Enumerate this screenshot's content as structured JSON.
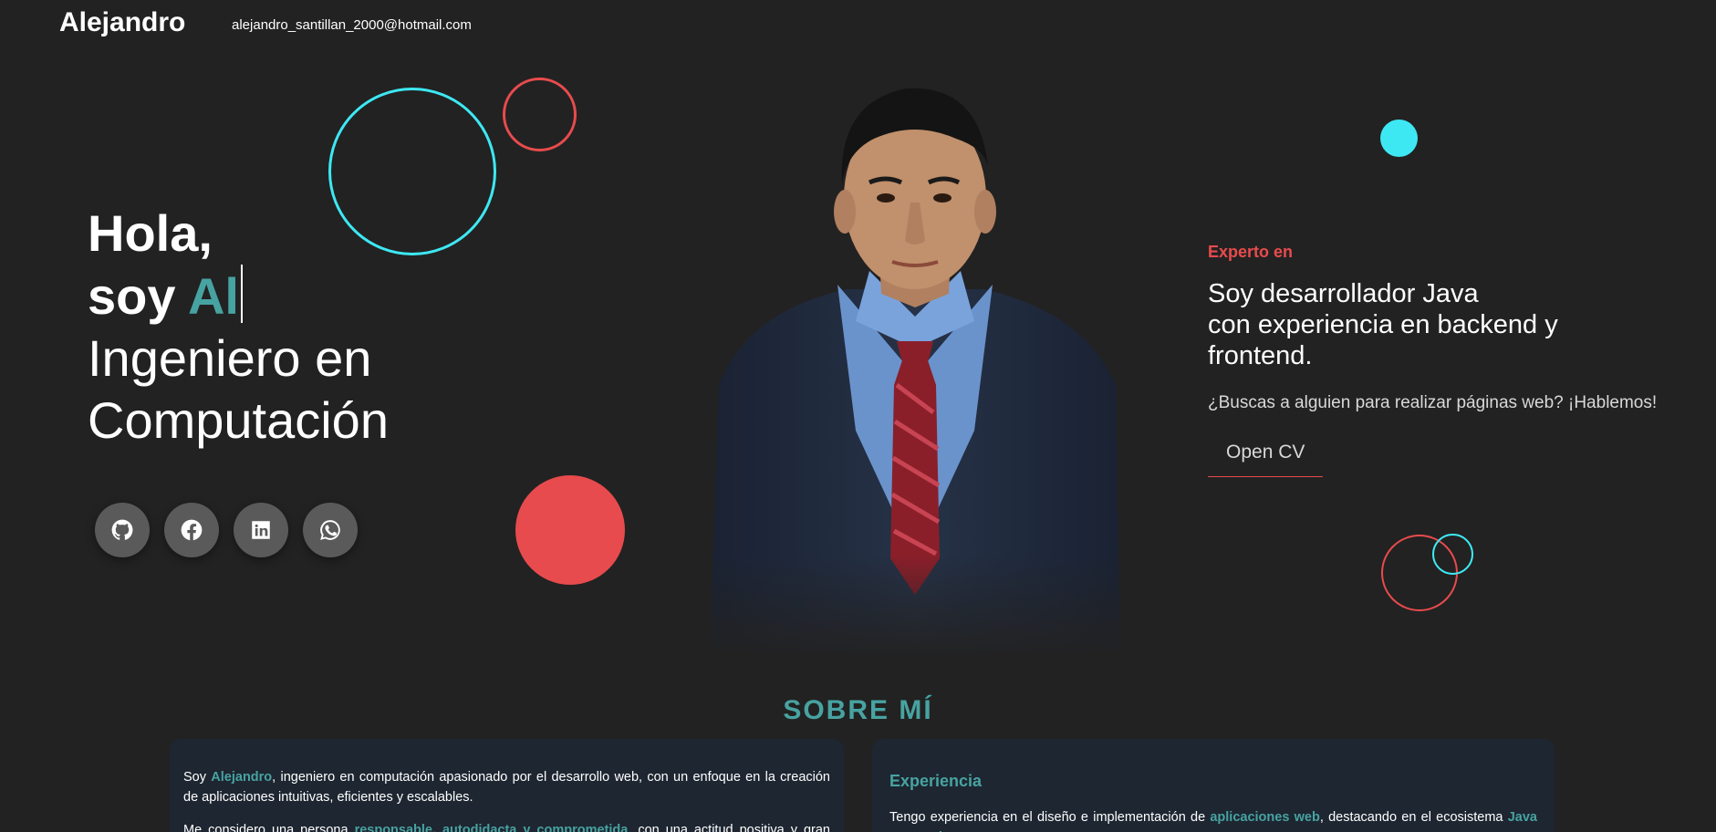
{
  "header": {
    "brand": "Alejandro",
    "email": "alejandro_santillan_2000@hotmail.com"
  },
  "hero": {
    "greeting": "Hola,",
    "soy_prefix": "soy ",
    "typed_text": "Al",
    "role_line1": "Ingeniero en",
    "role_line2": "Computación"
  },
  "socials": [
    {
      "icon": "github-icon"
    },
    {
      "icon": "facebook-icon"
    },
    {
      "icon": "linkedin-icon"
    },
    {
      "icon": "whatsapp-icon"
    }
  ],
  "expert": {
    "label": "Experto en",
    "line1": "Soy desarrollador Java",
    "line2": "con experiencia en backend y",
    "line3": "frontend.",
    "question": "¿Buscas a alguien para realizar páginas web? ¡Hablemos!",
    "cv_button": "Open CV"
  },
  "about": {
    "title": "SOBRE MÍ",
    "p1_a": "Soy ",
    "p1_name": "Alejandro",
    "p1_b": ", ingeniero en computación apasionado por el desarrollo web, con un enfoque en la creación de aplicaciones intuitivas, eficientes y escalables.",
    "p2_a": "Me considero una persona ",
    "p2_hl": "responsable, autodidacta y comprometida",
    "p2_b": ", con una actitud positiva y gran interés",
    "exp_title": "Experiencia",
    "exp_a": "Tengo experiencia en el diseño e implementación de ",
    "exp_hl1": "aplicaciones web",
    "exp_b": ", destacando en el ecosistema ",
    "exp_hl2": "Java con Spring Boot"
  },
  "colors": {
    "background": "#222222",
    "accent_teal": "#47a3a1",
    "accent_red": "#e84b4d",
    "accent_cyan": "#3ee8f3",
    "card": "#1e2631"
  }
}
